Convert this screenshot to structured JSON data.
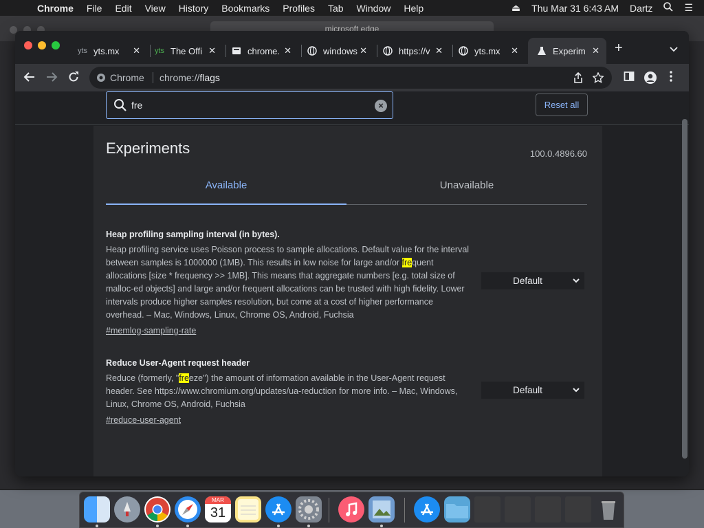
{
  "menubar": {
    "app": "Chrome",
    "items": [
      "File",
      "Edit",
      "View",
      "History",
      "Bookmarks",
      "Profiles",
      "Tab",
      "Window",
      "Help"
    ],
    "datetime": "Thu Mar 31  6:43 AM",
    "user": "Dartz"
  },
  "background_window": {
    "address": "microsoft edge"
  },
  "tabs": [
    {
      "title": "yts.mx"
    },
    {
      "title": "The Offi"
    },
    {
      "title": "chrome."
    },
    {
      "title": "windows"
    },
    {
      "title": "https://v"
    },
    {
      "title": "yts.mx"
    },
    {
      "title": "Experim"
    }
  ],
  "omnibox": {
    "chip": "Chrome",
    "url_prefix": "chrome://",
    "url_host": "flags"
  },
  "search": {
    "value": "fre"
  },
  "reset_label": "Reset all",
  "page": {
    "title": "Experiments",
    "version": "100.0.4896.60",
    "tab_available": "Available",
    "tab_unavailable": "Unavailable"
  },
  "experiments": [
    {
      "name": "Heap profiling sampling interval (in bytes).",
      "desc_before": "Heap profiling service uses Poisson process to sample allocations. Default value for the interval between samples is 1000000 (1MB). This results in low noise for large and/or ",
      "highlight": "fre",
      "desc_after": "quent allocations [size * frequency >> 1MB]. This means that aggregate numbers [e.g. total size of malloc-ed objects] and large and/or frequent allocations can be trusted with high fidelity. Lower intervals produce higher samples resolution, but come at a cost of higher performance overhead. – Mac, Windows, Linux, Chrome OS, Android, Fuchsia",
      "link": "#memlog-sampling-rate",
      "value": "Default"
    },
    {
      "name": "Reduce User-Agent request header",
      "desc_before": "Reduce (formerly, \"",
      "highlight": "fre",
      "desc_after": "eze\") the amount of information available in the User-Agent request header. See https://www.chromium.org/updates/ua-reduction for more info. – Mac, Windows, Linux, Chrome OS, Android, Fuchsia",
      "link": "#reduce-user-agent",
      "value": "Default"
    }
  ],
  "dock": {
    "apps": [
      "finder",
      "launchpad",
      "chrome",
      "safari",
      "calendar",
      "notes",
      "app-store",
      "system-preferences",
      "music",
      "preview",
      "app-store",
      "folder",
      "window-thumbnail",
      "window-thumbnail",
      "window-thumbnail",
      "window-thumbnail",
      "trash"
    ],
    "calendar_month": "MAR",
    "calendar_day": "31"
  },
  "colors": {
    "accent": "#8ab4f8",
    "highlight": "#ffff00",
    "background": "#202124",
    "card": "#292a2d"
  }
}
